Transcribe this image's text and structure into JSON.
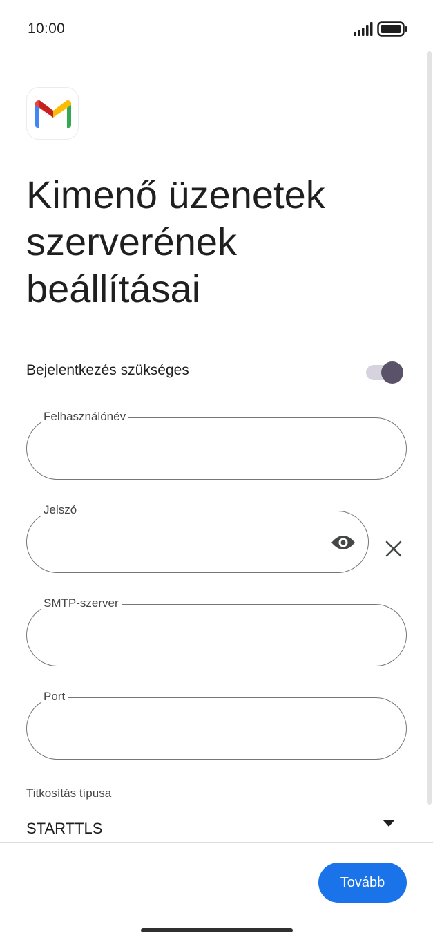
{
  "status_bar": {
    "time": "10:00",
    "signal_icon": "signal-bars-icon",
    "battery_icon": "battery-full-icon"
  },
  "app": {
    "logo_icon": "gmail-logo-icon"
  },
  "header": {
    "title": "Kimenő üzenetek szerverének beállításai"
  },
  "login_required": {
    "label": "Bejelentkezés szükséges",
    "enabled": true
  },
  "fields": {
    "username": {
      "label": "Felhasználónév",
      "value": ""
    },
    "password": {
      "label": "Jelszó",
      "value": "",
      "visibility_icon": "eye-icon",
      "clear_icon": "close-icon"
    },
    "smtp_server": {
      "label": "SMTP-szerver",
      "value": ""
    },
    "port": {
      "label": "Port",
      "value": ""
    }
  },
  "encryption": {
    "label": "Titkosítás típusa",
    "selected": "STARTTLS",
    "dropdown_icon": "dropdown-arrow-icon"
  },
  "footer": {
    "next_label": "Tovább"
  },
  "colors": {
    "primary_button": "#1a73e8",
    "toggle_thumb": "#5a5269",
    "toggle_track": "#d7d3de",
    "field_border": "#747775"
  }
}
